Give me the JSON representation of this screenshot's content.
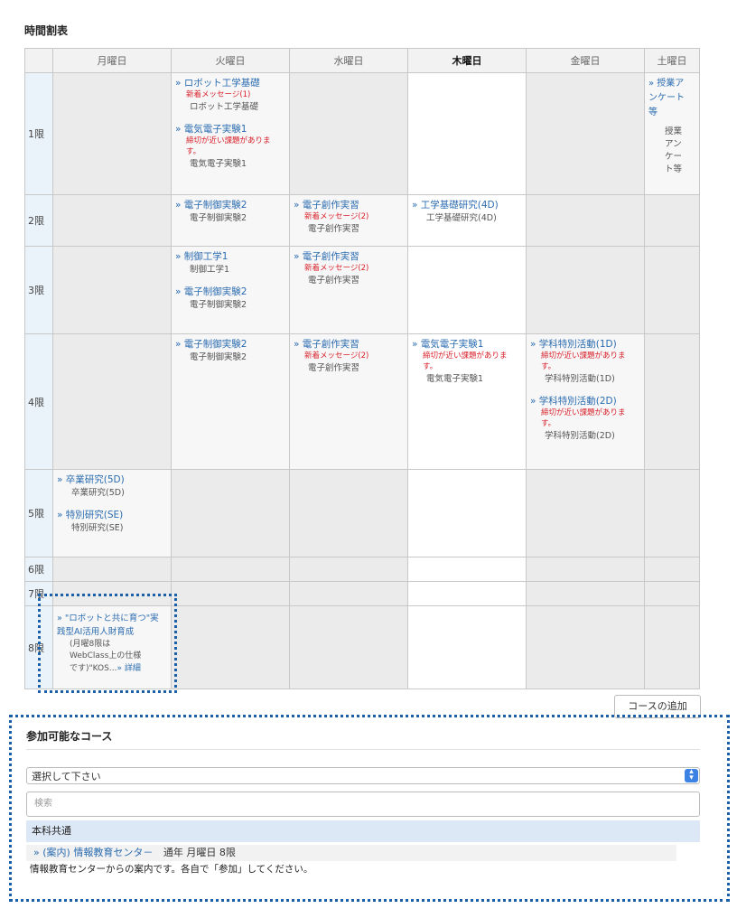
{
  "page": {
    "title": "時間割表"
  },
  "days": [
    "月曜日",
    "火曜日",
    "水曜日",
    "木曜日",
    "金曜日",
    "土曜日"
  ],
  "periods": [
    "1限",
    "2限",
    "3限",
    "4限",
    "5限",
    "6限",
    "7限",
    "8限"
  ],
  "cells": {
    "p1_tue": [
      {
        "link": "ロボット工学基礎",
        "news": "新着メッセージ(1)",
        "name": "ロボット工学基礎"
      },
      {
        "link": "電気電子実験1",
        "news": "締切が近い課題がありま\nす。",
        "name": "電気電子実験1"
      }
    ],
    "p1_sat": [
      {
        "link": "授業アンケート等",
        "news": "",
        "name": "授業アンケート等"
      }
    ],
    "p2_tue": [
      {
        "link": "電子制御実験2",
        "news": "",
        "name": "電子制御実験2"
      }
    ],
    "p2_wed": [
      {
        "link": "電子創作実習",
        "news": "新着メッセージ(2)",
        "name": "電子創作実習"
      }
    ],
    "p2_thu": [
      {
        "link": "工学基礎研究(4D)",
        "news": "",
        "name": "工学基礎研究(4D)"
      }
    ],
    "p3_tue": [
      {
        "link": "制御工学1",
        "news": "",
        "name": "制御工学1"
      },
      {
        "link": "電子制御実験2",
        "news": "",
        "name": "電子制御実験2"
      }
    ],
    "p3_wed": [
      {
        "link": "電子創作実習",
        "news": "新着メッセージ(2)",
        "name": "電子創作実習"
      }
    ],
    "p4_tue": [
      {
        "link": "電子制御実験2",
        "news": "",
        "name": "電子制御実験2"
      }
    ],
    "p4_wed": [
      {
        "link": "電子創作実習",
        "news": "新着メッセージ(2)",
        "name": "電子創作実習"
      }
    ],
    "p4_thu": [
      {
        "link": "電気電子実験1",
        "news": "締切が近い課題がありま\nす。",
        "name": "電気電子実験1"
      }
    ],
    "p4_fri": [
      {
        "link": "学科特別活動(1D)",
        "news": "締切が近い課題がありま\nす。",
        "name": "学科特別活動(1D)"
      },
      {
        "link": "学科特別活動(2D)",
        "news": "締切が近い課題がありま\nす。",
        "name": "学科特別活動(2D)"
      }
    ],
    "p5_mon": [
      {
        "link": "卒業研究(5D)",
        "news": "",
        "name": "卒業研究(5D)"
      },
      {
        "link": "特別研究(SE)",
        "news": "",
        "name": "特別研究(SE)"
      }
    ],
    "p8_mon": [
      {
        "link": "\"ロボットと共に育つ\"実践型AI活用人財育成",
        "news": "",
        "name": "(月曜8限は\nWebClass上の仕様\nです)\"KOS...",
        "detail": "» 詳細"
      }
    ]
  },
  "add_course_button": "コースの追加",
  "available": {
    "title": "参加可能なコース",
    "select_value": "選択して下さい",
    "search_placeholder": "検索",
    "group": "本科共通",
    "item_link": "(案内) 情報教育センタ－",
    "item_meta": "通年 月曜日 8限",
    "item_desc": "情報教育センターからの案内です。各自で「参加」してください。"
  }
}
